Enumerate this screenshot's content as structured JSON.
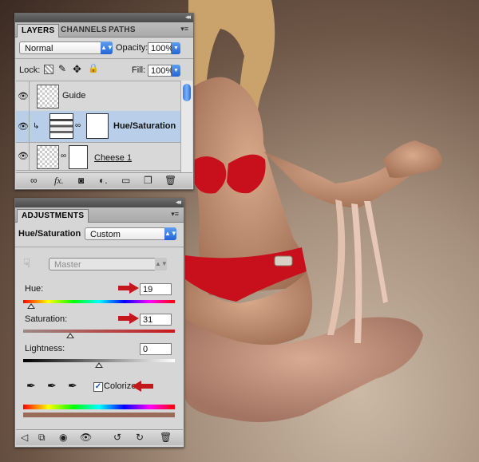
{
  "layers_panel": {
    "tabs": [
      "LAYERS",
      "CHANNELS",
      "PATHS"
    ],
    "blend_mode": "Normal",
    "opacity_label": "Opacity:",
    "opacity_value": "100%",
    "lock_label": "Lock:",
    "fill_label": "Fill:",
    "fill_value": "100%",
    "layers": [
      {
        "name": "Guide",
        "selected": false
      },
      {
        "name": "Hue/Saturation",
        "selected": true
      },
      {
        "name": "Cheese 1",
        "selected": false
      }
    ],
    "bottom_icons": [
      "link-icon",
      "fx-icon",
      "mask-icon",
      "adjustment-icon",
      "folder-icon",
      "new-layer-icon",
      "trash-icon"
    ],
    "bottom_fx_label": "fx."
  },
  "adjustments_panel": {
    "tab": "ADJUSTMENTS",
    "title": "Hue/Saturation",
    "preset": "Custom",
    "channel": "Master",
    "hue_label": "Hue:",
    "hue_value": "19",
    "saturation_label": "Saturation:",
    "saturation_value": "31",
    "lightness_label": "Lightness:",
    "lightness_value": "0",
    "colorize_label": "Colorize",
    "colorize_checked": true,
    "hue_level": 0.05,
    "saturation_level": 0.31,
    "lightness_level": 0.5,
    "colorize_color": "#9a6b58",
    "bottom_icons": [
      "back-icon",
      "clip-icon",
      "view-previous-icon",
      "visibility-icon",
      "reset-icon",
      "refresh-icon",
      "trash-icon"
    ]
  },
  "colors": {
    "annotation_arrow": "#c4171b",
    "selection_row": "#b9cfe9",
    "accent_blue": "#2364d6"
  }
}
